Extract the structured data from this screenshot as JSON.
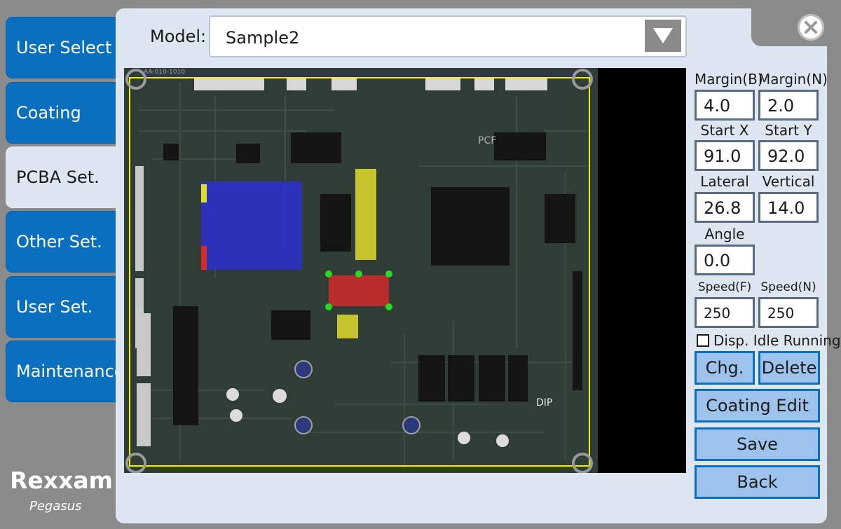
{
  "nav": {
    "items": [
      {
        "label": "User Select"
      },
      {
        "label": "Coating"
      },
      {
        "label": "PCBA Set."
      },
      {
        "label": "Other Set."
      },
      {
        "label": "User Set."
      },
      {
        "label": "Maintenance"
      }
    ],
    "active": "PCBA Set."
  },
  "model": {
    "label": "Model:",
    "value": "Sample2"
  },
  "params": {
    "margin_b": {
      "label": "Margin(B)",
      "value": "4.0"
    },
    "margin_n": {
      "label": "Margin(N)",
      "value": "2.0"
    },
    "start_x": {
      "label": "Start X",
      "value": "91.0"
    },
    "start_y": {
      "label": "Start Y",
      "value": "92.0"
    },
    "lateral": {
      "label": "Lateral",
      "value": "26.8"
    },
    "vertical": {
      "label": "Vertical",
      "value": "14.0"
    },
    "angle": {
      "label": "Angle",
      "value": "0.0"
    },
    "speed_f": {
      "label": "Speed(F)",
      "value": "250"
    },
    "speed_n": {
      "label": "Speed(N)",
      "value": "250"
    }
  },
  "disp_idle": {
    "label": "Disp. Idle Running",
    "checked": false
  },
  "buttons": {
    "chg": "Chg.",
    "delete": "Delete",
    "coating_edit": "Coating Edit",
    "save": "Save",
    "back": "Back"
  },
  "board": {
    "markings": {
      "top_code": "AA-010-1010",
      "pcf": "PCF",
      "dip": "DIP"
    }
  },
  "brand": {
    "name": "Rexxam",
    "product": "Pegasus"
  },
  "colors": {
    "nav_blue": "#0a6fbf",
    "panel": "#dde6f1",
    "button": "#9dc3ec",
    "region_blue": "#2a2fd0",
    "region_yellow": "#e0dc2a",
    "region_red": "#d42a2a",
    "handle_green": "#22dd22",
    "frame_yellow": "#f2f200"
  }
}
